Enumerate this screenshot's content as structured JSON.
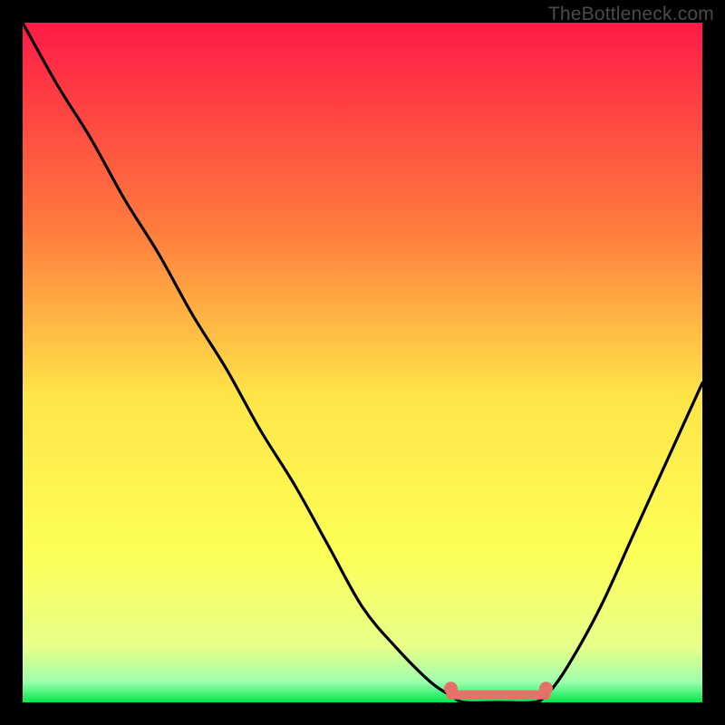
{
  "watermark": "TheBottleneck.com",
  "chart_data": {
    "type": "line",
    "title": "",
    "xlabel": "",
    "ylabel": "",
    "xlim": [
      0,
      100
    ],
    "ylim": [
      0,
      100
    ],
    "gradient": {
      "top": "#ff1a47",
      "upper_mid": "#ff994d",
      "mid": "#ffe548",
      "lower": "#f5ff82",
      "bottom": "#00e84e"
    },
    "curve": {
      "description": "Bottleneck percentage curve — V shape: falls from top-left, flat valley around x≈64–75, rises toward right edge",
      "x": [
        0,
        5,
        10,
        15,
        20,
        25,
        30,
        35,
        40,
        45,
        50,
        55,
        60,
        63,
        65,
        70,
        75,
        77,
        80,
        85,
        90,
        95,
        100
      ],
      "y": [
        100,
        91,
        83,
        74,
        66,
        57,
        49,
        40,
        32,
        23,
        14,
        8,
        3,
        1,
        0,
        0,
        0,
        1,
        5,
        14,
        25,
        36,
        47
      ]
    },
    "valley_marker": {
      "x_start": 63,
      "x_end": 77,
      "y": 1.5,
      "color": "#e77168"
    }
  }
}
